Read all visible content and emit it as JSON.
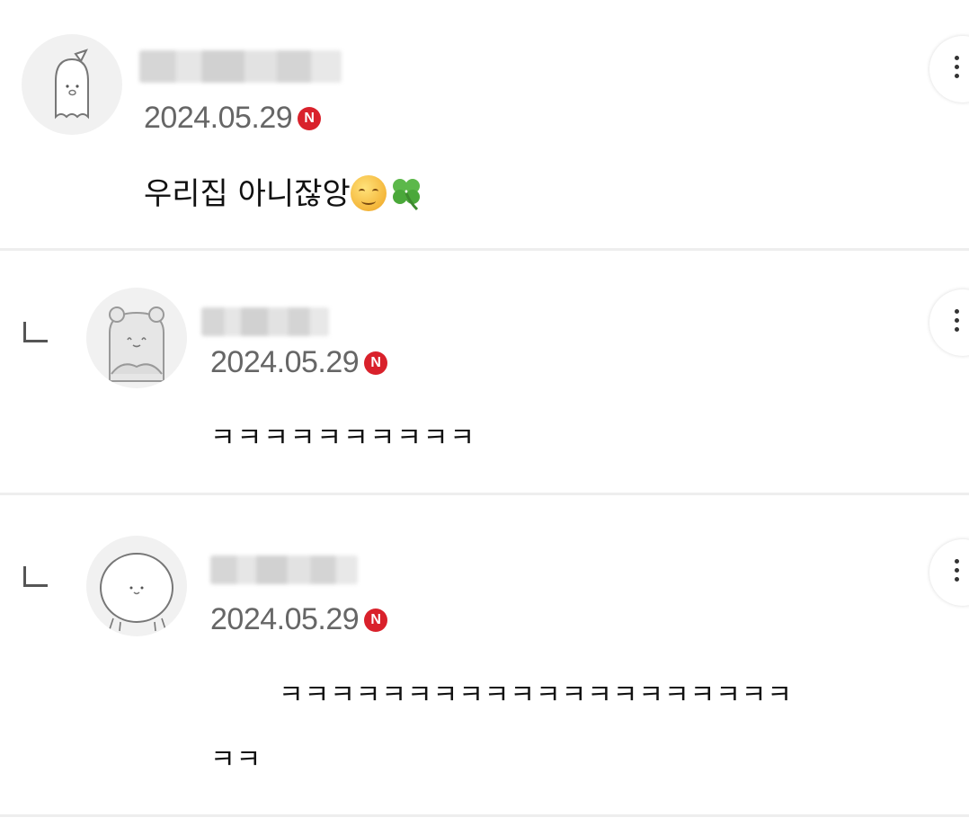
{
  "comments": [
    {
      "date": "2024.05.29",
      "badge": "N",
      "text": "우리집 아니잖앙",
      "emoji": [
        "smiling-face-icon",
        "four-leaf-clover-icon"
      ],
      "is_reply": false
    },
    {
      "date": "2024.05.29",
      "badge": "N",
      "text": "ㅋㅋㅋㅋㅋㅋㅋㅋㅋㅋ",
      "is_reply": true
    },
    {
      "date": "2024.05.29",
      "badge": "N",
      "text_line1": "ㅋㅋㅋㅋㅋㅋㅋㅋㅋㅋㅋㅋㅋㅋㅋㅋㅋㅋㅋㅋ",
      "text_line2": "ㅋㅋ",
      "is_reply": true
    }
  ],
  "colors": {
    "badge": "#d9212b",
    "date": "#666666",
    "divider": "#eeeeee"
  }
}
